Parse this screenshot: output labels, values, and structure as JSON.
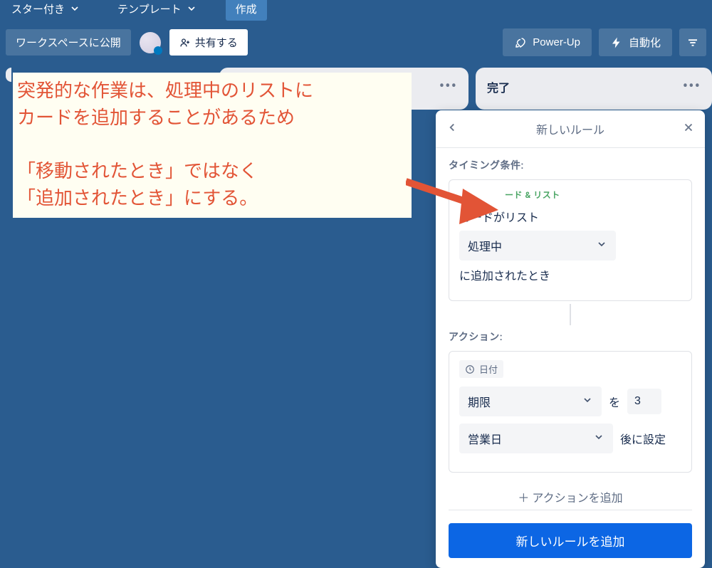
{
  "topnav": {
    "starred": "スター付き",
    "templates": "テンプレート",
    "create": "作成"
  },
  "secondbar": {
    "workspace_visibility": "ワークスペースに公開",
    "share": "共有する",
    "powerup": "Power-Up",
    "automation": "自動化"
  },
  "lists": {
    "done_title": "完了"
  },
  "annotation": {
    "line1": "突発的な作業は、処理中のリストに",
    "line2": "カードを追加することがあるため",
    "line3": "「移動されたとき」ではなく",
    "line4": "「追加されたとき」にする。"
  },
  "rule_panel": {
    "title": "新しいルール",
    "timing_label": "タイミング条件:",
    "trigger_card_title": "ード & リスト",
    "trigger_text_before": "カードがリスト",
    "trigger_select": "処理中",
    "trigger_text_after": "に追加されたとき",
    "action_label": "アクション:",
    "date_badge": "日付",
    "action_field_select": "期限",
    "action_conj1": "を",
    "action_num": "3",
    "action_unit_select": "営業日",
    "action_suffix": "後に設定",
    "add_action": "＋ アクションを追加",
    "submit": "新しいルールを追加"
  }
}
